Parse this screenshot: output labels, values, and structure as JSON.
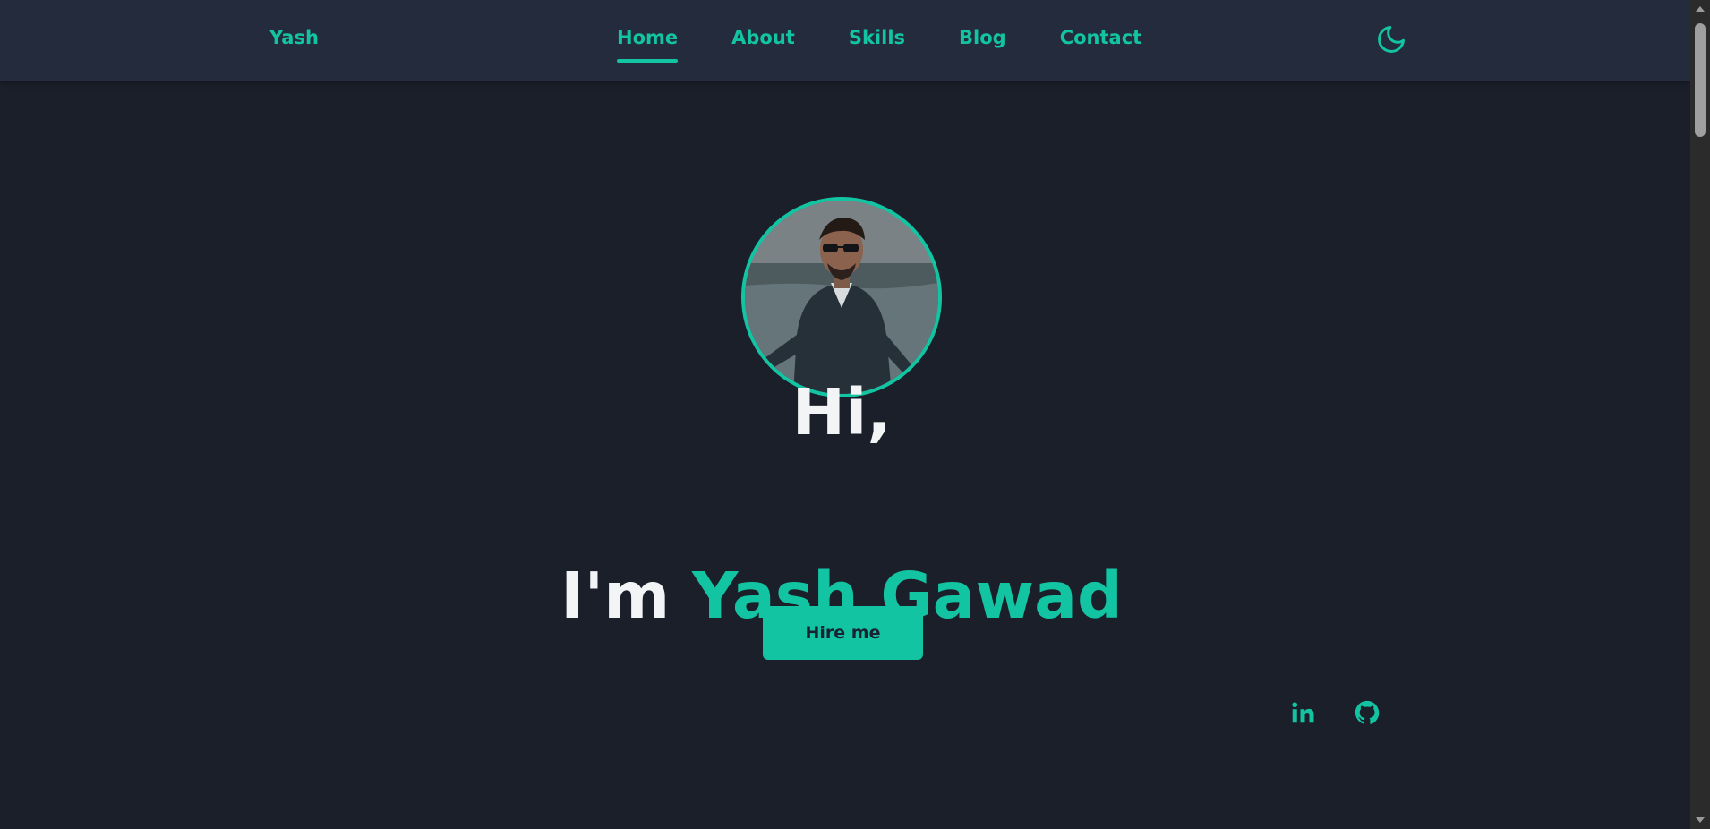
{
  "navbar": {
    "logo": "Yash",
    "links": [
      {
        "label": "Home",
        "active": true
      },
      {
        "label": "About",
        "active": false
      },
      {
        "label": "Skills",
        "active": false
      },
      {
        "label": "Blog",
        "active": false
      },
      {
        "label": "Contact",
        "active": false
      }
    ],
    "theme_toggle_icon": "moon-icon"
  },
  "hero": {
    "avatar_icon": "profile-photo",
    "greeting": "Hi,",
    "intro": "I'm",
    "name": "Yash Gawad",
    "hire_label": "Hire me"
  },
  "social": [
    {
      "icon": "linkedin-icon"
    },
    {
      "icon": "github-icon"
    }
  ],
  "colors": {
    "background": "#1a1f2a",
    "navbar": "#232b3c",
    "accent": "#13c4a3",
    "text_light": "#f3f4f6",
    "button_text": "#1a2333"
  }
}
